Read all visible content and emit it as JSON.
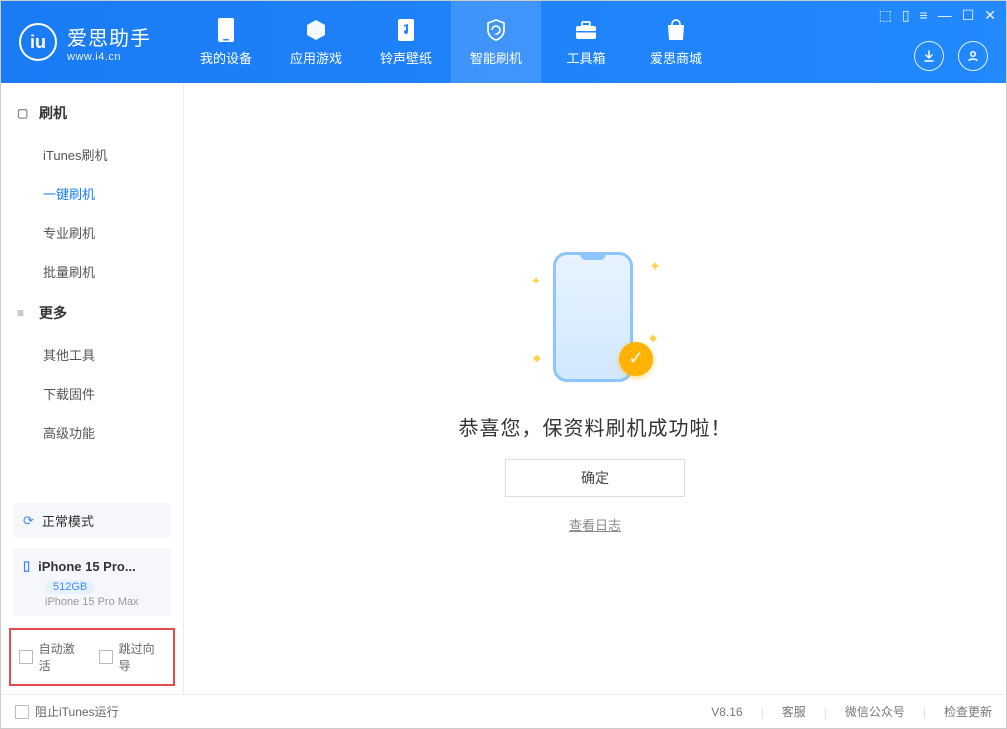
{
  "app": {
    "name": "爱思助手",
    "url": "www.i4.cn"
  },
  "nav": {
    "items": [
      {
        "label": "我的设备"
      },
      {
        "label": "应用游戏"
      },
      {
        "label": "铃声壁纸"
      },
      {
        "label": "智能刷机"
      },
      {
        "label": "工具箱"
      },
      {
        "label": "爱思商城"
      }
    ],
    "active_index": 3
  },
  "sidebar": {
    "group1": {
      "title": "刷机",
      "items": [
        {
          "label": "iTunes刷机"
        },
        {
          "label": "一键刷机"
        },
        {
          "label": "专业刷机"
        },
        {
          "label": "批量刷机"
        }
      ],
      "active_index": 1
    },
    "group2": {
      "title": "更多",
      "items": [
        {
          "label": "其他工具"
        },
        {
          "label": "下载固件"
        },
        {
          "label": "高级功能"
        }
      ]
    },
    "mode_label": "正常模式",
    "device": {
      "name": "iPhone 15 Pro...",
      "storage": "512GB",
      "full_name": "iPhone 15 Pro Max"
    },
    "options": {
      "auto_activate": "自动激活",
      "skip_wizard": "跳过向导"
    }
  },
  "main": {
    "success_text": "恭喜您，保资料刷机成功啦！",
    "ok_button": "确定",
    "view_log": "查看日志"
  },
  "footer": {
    "block_itunes": "阻止iTunes运行",
    "version": "V8.16",
    "support": "客服",
    "wechat": "微信公众号",
    "check_update": "检查更新"
  }
}
